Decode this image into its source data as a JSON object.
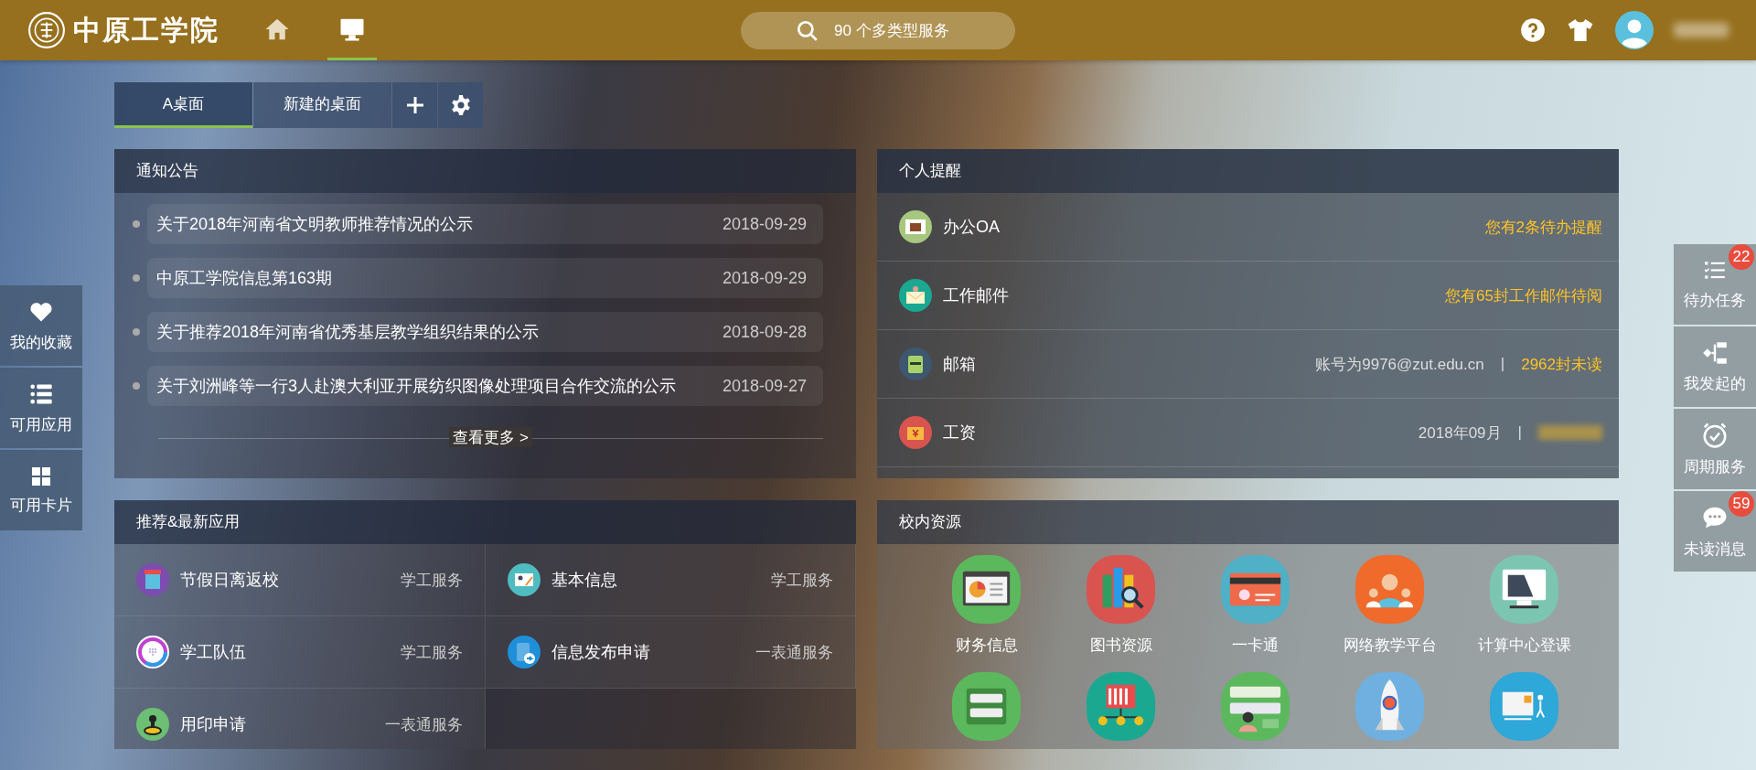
{
  "header": {
    "logo_text": "中原工学院",
    "nav": [
      {
        "kind": "home",
        "selected": false
      },
      {
        "kind": "desktop",
        "selected": true
      }
    ],
    "search": {
      "placeholder": "90 个多类型服务"
    }
  },
  "tabs": [
    {
      "label": "A桌面",
      "selected": true
    },
    {
      "label": "新建的桌面",
      "selected": false
    }
  ],
  "left_sidebar": [
    {
      "kind": "heart",
      "label": "我的收藏"
    },
    {
      "kind": "list",
      "label": "可用应用"
    },
    {
      "kind": "grid",
      "label": "可用卡片"
    }
  ],
  "right_sidebar": [
    {
      "kind": "tasks",
      "label": "待办任务",
      "badge": "22"
    },
    {
      "kind": "flow",
      "label": "我发起的"
    },
    {
      "kind": "clock",
      "label": "周期服务"
    },
    {
      "kind": "chat",
      "label": "未读消息",
      "badge": "59"
    }
  ],
  "notices": {
    "title": "通知公告",
    "items": [
      {
        "title": "关于2018年河南省文明教师推荐情况的公示",
        "date": "2018-09-29"
      },
      {
        "title": "中原工学院信息第163期",
        "date": "2018-09-29"
      },
      {
        "title": "关于推荐2018年河南省优秀基层教学组织结果的公示",
        "date": "2018-09-28"
      },
      {
        "title": "关于刘洲峰等一行3人赴澳大利亚开展纺织图像处理项目合作交流的公示",
        "date": "2018-09-27"
      }
    ],
    "more": "查看更多 >"
  },
  "reminders": {
    "title": "个人提醒",
    "items": [
      {
        "kind": "oa",
        "name": "办公OA",
        "info": "您有2条待办提醒"
      },
      {
        "kind": "mail",
        "name": "工作邮件",
        "info": "您有65封工作邮件待阅"
      },
      {
        "kind": "mailbox",
        "name": "邮箱",
        "detail": "账号为9976@zut.edu.cn",
        "separator": "|",
        "info": "2962封未读"
      },
      {
        "kind": "salary",
        "name": "工资",
        "detail": "2018年09月",
        "separator": "|"
      }
    ]
  },
  "apps": {
    "title": "推荐&最新应用",
    "items": [
      {
        "kind": "building",
        "name": "节假日离返校",
        "category": "学工服务"
      },
      {
        "kind": "idcard",
        "name": "基本信息",
        "category": "学工服务"
      },
      {
        "kind": "ring",
        "name": "学工队伍",
        "category": "学工服务"
      },
      {
        "kind": "doc",
        "name": "信息发布申请",
        "category": "一表通服务"
      },
      {
        "kind": "stamp",
        "name": "用印申请",
        "category": "一表通服务"
      }
    ]
  },
  "resources": {
    "title": "校内资源",
    "items": [
      {
        "kind": "finance",
        "label": "财务信息"
      },
      {
        "kind": "books",
        "label": "图书资源"
      },
      {
        "kind": "card",
        "label": "一卡通"
      },
      {
        "kind": "people",
        "label": "网络教学平台"
      },
      {
        "kind": "monitor",
        "label": "计算中心登课"
      },
      {
        "kind": "server"
      },
      {
        "kind": "network"
      },
      {
        "kind": "login"
      },
      {
        "kind": "rocket"
      },
      {
        "kind": "express"
      }
    ]
  }
}
